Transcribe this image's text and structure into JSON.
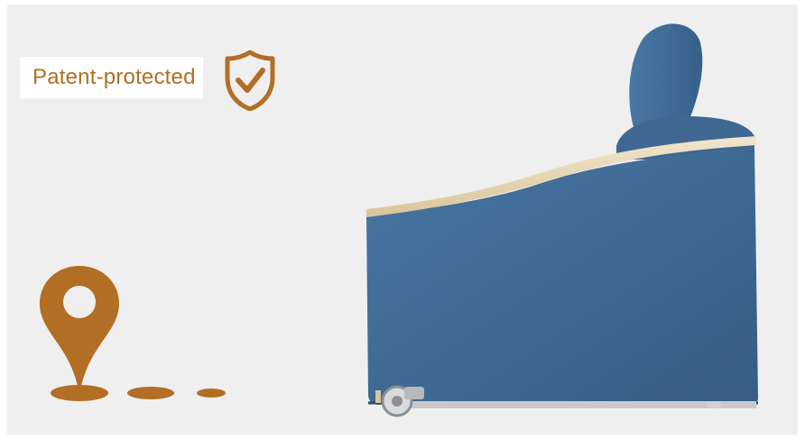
{
  "badge": {
    "label": "Patent-protected",
    "icon": "shield-check-icon"
  },
  "location_marker": {
    "icon": "map-pin-icon"
  },
  "colors": {
    "accent": "#b26e25",
    "background": "#efeff0",
    "upholstery": "#3f6a94",
    "armrest_wood": "#e8d9b8"
  }
}
